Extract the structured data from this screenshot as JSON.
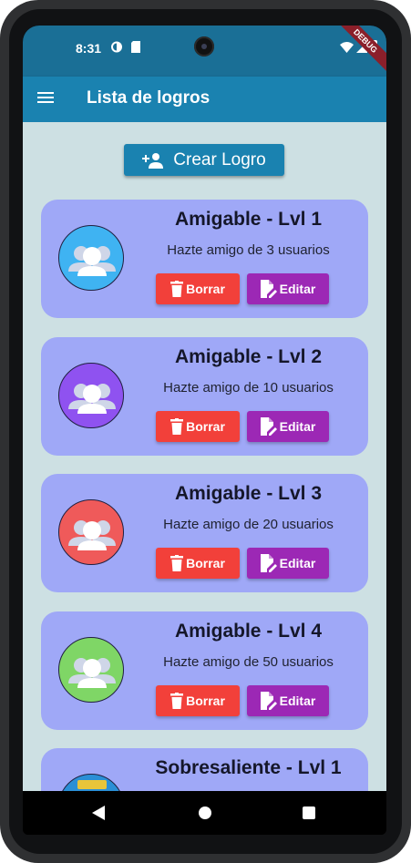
{
  "status_bar": {
    "time": "8:31",
    "debug_label": "DEBUG"
  },
  "app_bar": {
    "title": "Lista de logros"
  },
  "create_button": {
    "label": "Crear Logro"
  },
  "achievements": [
    {
      "title": "Amigable - Lvl 1",
      "description": "Hazte amigo de 3 usuarios",
      "color": "#3fb3f2",
      "icon": "users-icon"
    },
    {
      "title": "Amigable - Lvl 2",
      "description": "Hazte amigo de 10 usuarios",
      "color": "#8f52f0",
      "icon": "users-icon"
    },
    {
      "title": "Amigable - Lvl 3",
      "description": "Hazte amigo de 20 usuarios",
      "color": "#ef5a5a",
      "icon": "users-icon"
    },
    {
      "title": "Amigable - Lvl 4",
      "description": "Hazte amigo de 50 usuarios",
      "color": "#7fd666",
      "icon": "users-icon"
    },
    {
      "title": "Sobresaliente - Lvl 1",
      "description": "",
      "color": "#2a8fd6",
      "icon": "trophy-icon"
    }
  ],
  "card_buttons": {
    "delete_label": "Borrar",
    "edit_label": "Editar"
  },
  "colors": {
    "app_bar": "#1a82b0",
    "background": "#cde0e3",
    "card": "#9fa8f7",
    "delete": "#f2403a",
    "edit": "#9c28b5"
  }
}
